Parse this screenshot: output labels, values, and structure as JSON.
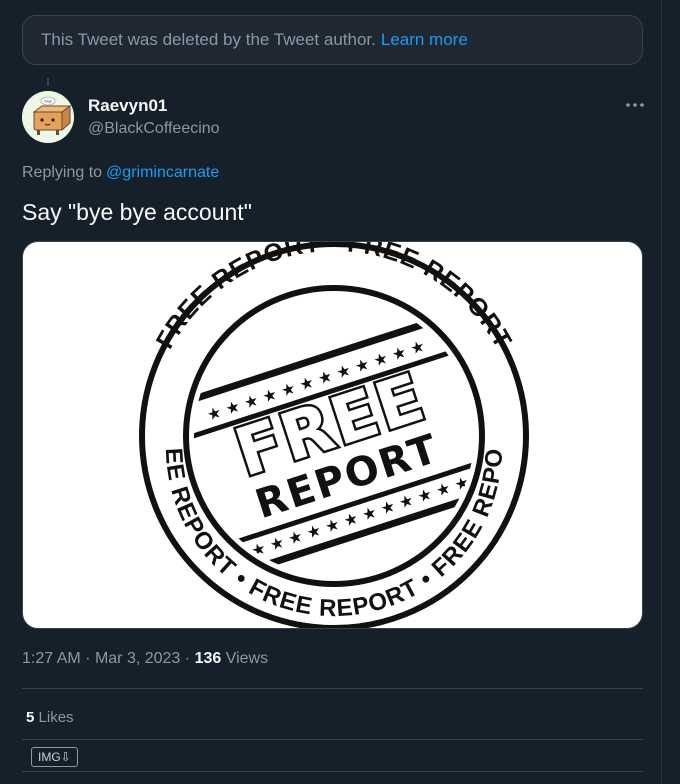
{
  "deleted_notice": {
    "text": "This Tweet was deleted by the Tweet author.",
    "link": "Learn more"
  },
  "author": {
    "display_name": "Raevyn01",
    "handle": "@BlackCoffeecino",
    "avatar_text": "Slap"
  },
  "reply": {
    "prefix": "Replying to",
    "to": "@grimincarnate"
  },
  "tweet": {
    "text": "Say \"bye bye account\""
  },
  "media": {
    "ring_text_top": "FREE REPORT • FREE REPORT",
    "ring_text_bottom": "FREE REPORT • FREE REPORT • FREE REPORT",
    "center_line1": "FREE",
    "center_line2": "REPORT"
  },
  "meta": {
    "time": "1:27 AM",
    "sep1": "·",
    "date": "Mar 3, 2023",
    "sep2": "·",
    "views_count": "136",
    "views_label": "Views"
  },
  "stats": {
    "likes_count": "5",
    "likes_label": "Likes"
  },
  "badge": {
    "label": "IMG⇩"
  },
  "colors": {
    "background": "#15202b",
    "accent": "#1d9bf0",
    "muted": "#8b98a5",
    "border": "#38444d"
  }
}
